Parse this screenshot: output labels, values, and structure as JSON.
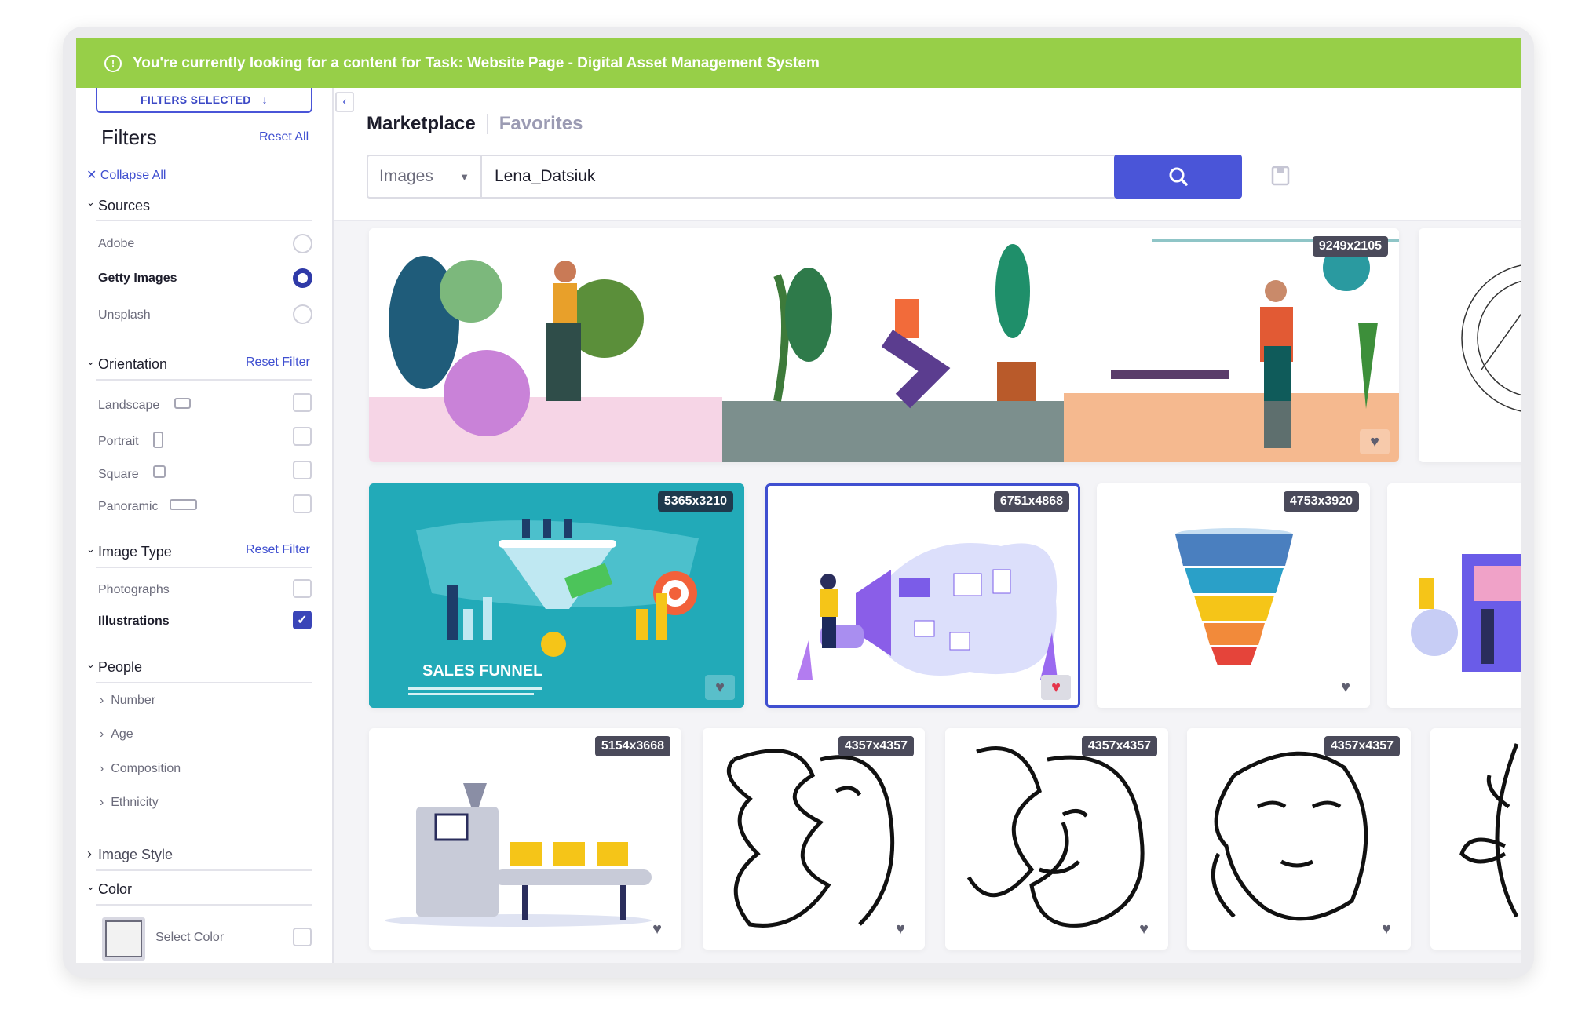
{
  "banner": {
    "text": "You're currently looking for a content for Task: Website Page - Digital Asset Management System",
    "icon": "alert-circle-icon"
  },
  "sidebar": {
    "filters_selected": "FILTERS SELECTED",
    "title": "Filters",
    "reset_all": "Reset All",
    "collapse_all": "Collapse All",
    "reset_filter": "Reset Filter",
    "sources": {
      "title": "Sources",
      "options": [
        {
          "label": "Adobe",
          "selected": false
        },
        {
          "label": "Getty Images",
          "selected": true
        },
        {
          "label": "Unsplash",
          "selected": false
        }
      ]
    },
    "orientation": {
      "title": "Orientation",
      "options": [
        {
          "label": "Landscape",
          "checked": false
        },
        {
          "label": "Portrait",
          "checked": false
        },
        {
          "label": "Square",
          "checked": false
        },
        {
          "label": "Panoramic",
          "checked": false
        }
      ]
    },
    "image_type": {
      "title": "Image Type",
      "options": [
        {
          "label": "Photographs",
          "checked": false
        },
        {
          "label": "Illustrations",
          "checked": true
        }
      ]
    },
    "people": {
      "title": "People",
      "items": [
        "Number",
        "Age",
        "Composition",
        "Ethnicity"
      ]
    },
    "image_style": {
      "title": "Image Style"
    },
    "color": {
      "title": "Color",
      "select": "Select Color"
    }
  },
  "main": {
    "tabs": [
      {
        "label": "Marketplace",
        "active": true
      },
      {
        "label": "Favorites",
        "active": false
      }
    ],
    "search": {
      "type": "Images",
      "query": "Lena_Datsiuk"
    },
    "accent": "#4a55d8",
    "tiles": [
      {
        "size": "9249x2105",
        "favorite": false
      },
      {
        "size": "",
        "favorite": false
      },
      {
        "size": "5365x3210",
        "favorite": false,
        "caption": "SALES FUNNEL"
      },
      {
        "size": "6751x4868",
        "favorite": true,
        "selected": true
      },
      {
        "size": "4753x3920",
        "favorite": false
      },
      {
        "size": "",
        "favorite": false
      },
      {
        "size": "5154x3668",
        "favorite": false
      },
      {
        "size": "4357x4357",
        "favorite": false
      },
      {
        "size": "4357x4357",
        "favorite": false
      },
      {
        "size": "4357x4357",
        "favorite": false
      },
      {
        "size": "",
        "favorite": false
      }
    ]
  }
}
